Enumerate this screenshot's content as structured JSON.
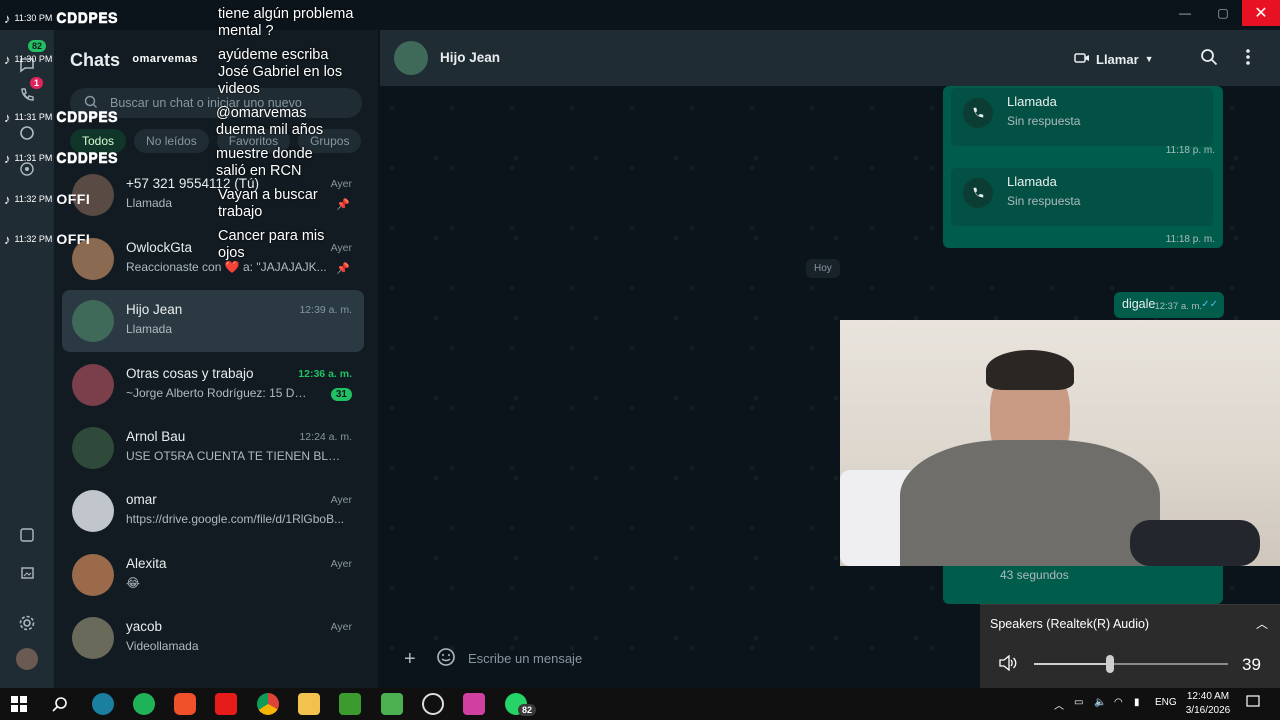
{
  "window": {
    "minimize": "—",
    "maximize": "▢",
    "close": "✕"
  },
  "rail": {
    "chats_badge": "82",
    "calls_badge": "1"
  },
  "chat_list": {
    "title": "Chats",
    "search_placeholder": "Buscar un chat o iniciar uno nuevo",
    "filters": [
      "Todos",
      "No leídos",
      "Favoritos",
      "Grupos"
    ],
    "items": [
      {
        "name": "+57 321 9554112 (Tú)",
        "time": "Ayer",
        "message": "Llamada",
        "pinned": true
      },
      {
        "name": "OwlockGta",
        "time": "Ayer",
        "message": "Reaccionaste con ❤️ a: \"JAJAJAJK...",
        "pinned": true
      },
      {
        "name": "Hijo Jean",
        "time": "12:39 a. m.",
        "message": "Llamada",
        "selected": true
      },
      {
        "name": "Otras cosas y trabajo",
        "time": "12:36 a. m.",
        "message": "~Jorge Alberto Rodríguez: 15 DE...",
        "unread": "31"
      },
      {
        "name": "Arnol Bau",
        "time": "12:24 a. m.",
        "message": "USE OT5RA CUENTA TE TIENEN BLO..."
      },
      {
        "name": "omar",
        "time": "Ayer",
        "message": "https://drive.google.com/file/d/1RlGboB..."
      },
      {
        "name": "Alexita",
        "time": "Ayer",
        "message": "😂"
      },
      {
        "name": "yacob",
        "time": "Ayer",
        "message": "Videollamada"
      }
    ]
  },
  "conversation": {
    "contact": "Hijo Jean",
    "call_button": "Llamar",
    "messages": [
      {
        "title": "Llamada",
        "sub": "Sin respuesta",
        "time": "11:18 p. m."
      },
      {
        "title": "Llamada",
        "sub": "Sin respuesta",
        "time": "11:18 p. m."
      }
    ],
    "day_separator": "Hoy",
    "text_message": {
      "text": "digale",
      "time": "12:37 a. m."
    },
    "last_call_sub": "43 segundos",
    "composer_placeholder": "Escribe un mensaje"
  },
  "tiktok_overlay": {
    "rows": [
      {
        "time": "11:30 PM",
        "name": "𝐂𝐃𝐃𝐏𝐄𝐒"
      },
      {
        "time": "11:30 PM",
        "name": "omarvemas"
      },
      {
        "time": "11:31 PM",
        "name": "𝐂𝐃𝐃𝐏𝐄𝐒"
      },
      {
        "time": "11:31 PM",
        "name": "𝐂𝐃𝐃𝐏𝐄𝐒"
      },
      {
        "time": "11:32 PM",
        "name": "OFFI"
      },
      {
        "time": "11:32 PM",
        "name": "OFFI"
      }
    ],
    "comments": [
      "tiene algún problema mental ?",
      "ayúdeme escriba José Gabriel en los videos",
      "@omarvemas duerma mil años",
      "muestre donde salió en RCN",
      "Vayan a buscar trabajo",
      "Cancer para mis ojos"
    ]
  },
  "volume": {
    "device": "Speakers (Realtek(R) Audio)",
    "level": 39
  },
  "taskbar": {
    "whatsapp_badge": "82",
    "lang": "ENG",
    "time": "12:40 AM",
    "date": "3/16/2026"
  },
  "colors": {
    "accent": "#21c063",
    "bubble": "#005c4b",
    "panel": "#202c33",
    "bg": "#0b141a"
  }
}
